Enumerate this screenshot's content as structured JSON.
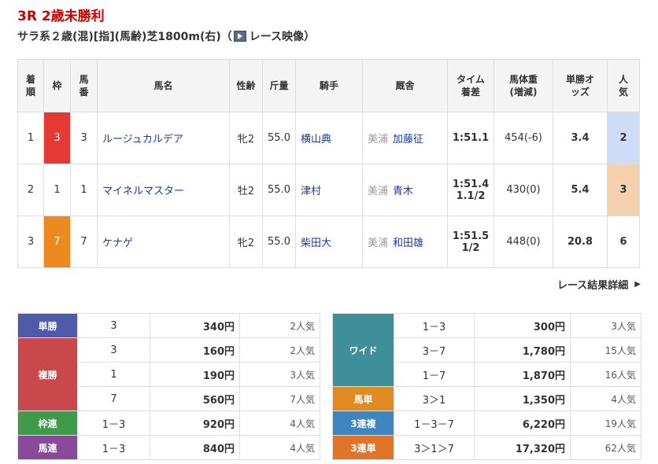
{
  "race": {
    "title": "3R 2歳未勝利",
    "info_prefix": "サラ系２歳(混)[指](馬齢)芝1800m(右)（",
    "video_label": "レース映像",
    "info_suffix": "）"
  },
  "result_table": {
    "headers": {
      "rank": "着順",
      "waku": "枠",
      "num": "馬番",
      "horse": "馬名",
      "sexage": "性齢",
      "weight": "斤量",
      "jockey": "騎手",
      "trainer": "厩舎",
      "time": "タイム着差",
      "body": "馬体重(増減)",
      "odds": "単勝オッズ",
      "pop": "人気"
    },
    "rows": [
      {
        "rank": "1",
        "waku": "3",
        "num": "3",
        "horse": "ルージュカルデア",
        "sexage": "牝2",
        "weight": "55.0",
        "jockey": "横山典",
        "region": "美浦",
        "trainer": "加藤征",
        "time": "1:51.1",
        "margin": "",
        "body": "454(-6)",
        "odds": "3.4",
        "pop": "2"
      },
      {
        "rank": "2",
        "waku": "1",
        "num": "1",
        "horse": "マイネルマスター",
        "sexage": "牡2",
        "weight": "55.0",
        "jockey": "津村",
        "region": "美浦",
        "trainer": "青木",
        "time": "1:51.4",
        "margin": "1.1/2",
        "body": "430(0)",
        "odds": "5.4",
        "pop": "3"
      },
      {
        "rank": "3",
        "waku": "7",
        "num": "7",
        "horse": "ケナゲ",
        "sexage": "牝2",
        "weight": "55.0",
        "jockey": "柴田大",
        "region": "美浦",
        "trainer": "和田雄",
        "time": "1:51.5",
        "margin": "1/2",
        "body": "448(0)",
        "odds": "20.8",
        "pop": "6"
      }
    ]
  },
  "detail_link": "レース結果詳細",
  "payouts_left": {
    "tan": {
      "label": "単勝",
      "rows": [
        {
          "combo": "3",
          "yen": "340円",
          "pop": "2人気"
        }
      ]
    },
    "fuku": {
      "label": "複勝",
      "rows": [
        {
          "combo": "3",
          "yen": "160円",
          "pop": "2人気"
        },
        {
          "combo": "1",
          "yen": "190円",
          "pop": "3人気"
        },
        {
          "combo": "7",
          "yen": "560円",
          "pop": "7人気"
        }
      ]
    },
    "waku": {
      "label": "枠連",
      "rows": [
        {
          "combo": "1－3",
          "yen": "920円",
          "pop": "4人気"
        }
      ]
    },
    "uma": {
      "label": "馬連",
      "rows": [
        {
          "combo": "1－3",
          "yen": "840円",
          "pop": "4人気"
        }
      ]
    }
  },
  "payouts_right": {
    "wide": {
      "label": "ワイド",
      "rows": [
        {
          "combo": "1－3",
          "yen": "300円",
          "pop": "3人気"
        },
        {
          "combo": "3－7",
          "yen": "1,780円",
          "pop": "15人気"
        },
        {
          "combo": "1－7",
          "yen": "1,870円",
          "pop": "16人気"
        }
      ]
    },
    "umatan": {
      "label": "馬単",
      "rows": [
        {
          "combo": "3＞1",
          "yen": "1,350円",
          "pop": "4人気"
        }
      ]
    },
    "sanpuku": {
      "label": "3連複",
      "rows": [
        {
          "combo": "1－3－7",
          "yen": "6,220円",
          "pop": "19人気"
        }
      ]
    },
    "santan": {
      "label": "3連単",
      "rows": [
        {
          "combo": "3＞1＞7",
          "yen": "17,320円",
          "pop": "62人気"
        }
      ]
    }
  },
  "colors": {
    "title_red": "#cc0000",
    "link_blue": "#1a3a9c",
    "waku3": "#e53935",
    "waku7": "#ec8a21"
  }
}
